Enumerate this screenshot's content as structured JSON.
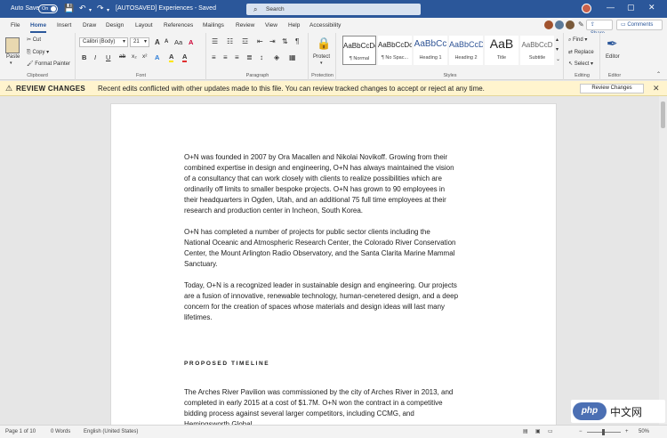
{
  "titlebar": {
    "autosave_label": "Auto Save",
    "autosave_state": "On",
    "save_icon": "save-icon",
    "undo_icon": "undo-icon",
    "redo_icon": "redo-icon",
    "doc_title": "[AUTOSAVED] Experiences",
    "saved_status": "- Saved",
    "search_placeholder": "Search",
    "minimize_glyph": "—",
    "maximize_glyph": "▢",
    "close_glyph": "✕",
    "bg_color": "#2b579a"
  },
  "ribbon_tabs": [
    "File",
    "Home",
    "Insert",
    "Draw",
    "Design",
    "Layout",
    "References",
    "Mailings",
    "Review",
    "View",
    "Help",
    "Accessibility"
  ],
  "ribbon_actions": {
    "share": "Share",
    "comments": "Comments"
  },
  "clipboard": {
    "paste": "Paste",
    "cut": "Cut",
    "copy": "Copy",
    "format_painter": "Format Painter",
    "group": "Clipboard"
  },
  "font": {
    "name": "Calibri (Body)",
    "size": "21",
    "bold": "B",
    "italic": "I",
    "underline": "U",
    "grow": "A",
    "shrink": "A",
    "case": "Aa",
    "clear": "A",
    "highlight": "A",
    "color": "A",
    "group": "Font"
  },
  "paragraph": {
    "group": "Paragraph"
  },
  "protection": {
    "label": "Protect",
    "group": "Protection"
  },
  "styles": {
    "group": "Styles",
    "items": [
      {
        "preview": "AaBbCcDc",
        "name": "¶ Normal"
      },
      {
        "preview": "AaBbCcDc",
        "name": "¶ No Spac..."
      },
      {
        "preview": "AaBbCc",
        "name": "Heading 1"
      },
      {
        "preview": "AaBbCcD",
        "name": "Heading 2"
      },
      {
        "preview": "AaB",
        "name": "Title"
      },
      {
        "preview": "AaBbCcD",
        "name": "Subtitle"
      }
    ]
  },
  "editing": {
    "find": "Find",
    "replace": "Replace",
    "select": "Select",
    "group": "Editing"
  },
  "editor": {
    "label": "Editor",
    "group": "Editor"
  },
  "banner": {
    "title": "REVIEW CHANGES",
    "message": "Recent edits conflicted with other updates made to this file. You can review tracked changes to accept or reject at any time.",
    "button": "Review Changes",
    "bg_color": "#fff4ce"
  },
  "document": {
    "paragraphs": [
      [
        "O+N was founded in 2007 by Ora Macallen and Nikolai Novikoff. Growing from their",
        "combined expertise in design and engineering, O+N has always maintained the vision",
        "of a consultancy that can work closely with clients to realize possibilities which are",
        "ordinarily off limits to smaller bespoke projects. O+N has grown to 90 employees in",
        "their headquarters in Ogden, Utah, and an additional 75 full time employees at their",
        "research and production center in Incheon, South Korea."
      ],
      [
        "O+N has completed a number of projects for public sector clients including the",
        "National Oceanic and Atmospheric Research Center, the Colorado River Conservation",
        "Center, the Mount Arlington Radio Observatory, and the Santa Clarita Marine Mammal",
        "Sanctuary."
      ],
      [
        "Today, O+N is a recognized leader in sustainable design and engineering. Our projects",
        "are a fusion of innovative, renewable technology, human-cenetered design, and a deep",
        "concern for the creation of spaces whose materials and design ideas will last many",
        "lifetimes."
      ]
    ],
    "heading": "PROPOSED TIMELINE",
    "last_paragraph": [
      "The Arches River Pavilion was commissioned by the city of Arches River in 2013, and",
      "completed in early 2015 at a cost of $1.7M. O+N won the contract in a competitive",
      "bidding process against several larger competitors, including CCMG, and",
      "Hemingsworth Global."
    ]
  },
  "statusbar": {
    "page": "Page 1 of 10",
    "words": "0 Words",
    "language": "English (United States)",
    "zoom": "50%"
  },
  "watermark": {
    "logo": "php",
    "text": "中文网"
  }
}
